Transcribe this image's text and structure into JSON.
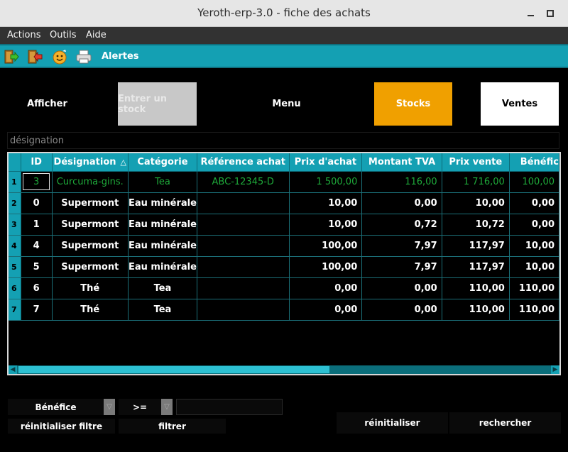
{
  "window": {
    "title": "Yeroth-erp-3.0 - fiche des achats"
  },
  "menubar": {
    "items": [
      "Actions",
      "Outils",
      "Aide"
    ]
  },
  "toolbar": {
    "alert_label": "Alertes"
  },
  "actions": {
    "afficher": "Afficher",
    "entrer_stock": "Entrer un stock",
    "menu": "Menu",
    "stocks": "Stocks",
    "ventes": "Ventes"
  },
  "search": {
    "placeholder": "désignation",
    "value": ""
  },
  "table": {
    "columns": [
      "ID",
      "Désignation",
      "Catégorie",
      "Référence achat",
      "Prix d'achat",
      "Montant TVA",
      "Prix vente",
      "Bénéfic"
    ],
    "sorted_column": "Désignation",
    "rows": [
      {
        "num": "1",
        "cells": [
          "3",
          "Curcuma-gins.",
          "Tea",
          "ABC-12345-D",
          "1 500,00",
          "116,00",
          "1 716,00",
          "100,00"
        ]
      },
      {
        "num": "2",
        "cells": [
          "0",
          "Supermont",
          "Eau minérale",
          "",
          "10,00",
          "0,00",
          "10,00",
          "0,00"
        ]
      },
      {
        "num": "3",
        "cells": [
          "1",
          "Supermont",
          "Eau minérale",
          "",
          "10,00",
          "0,72",
          "10,72",
          "0,00"
        ]
      },
      {
        "num": "4",
        "cells": [
          "4",
          "Supermont",
          "Eau minérale",
          "",
          "100,00",
          "7,97",
          "117,97",
          "10,00"
        ]
      },
      {
        "num": "5",
        "cells": [
          "5",
          "Supermont",
          "Eau minérale",
          "",
          "100,00",
          "7,97",
          "117,97",
          "10,00"
        ]
      },
      {
        "num": "6",
        "cells": [
          "6",
          "Thé",
          "Tea",
          "",
          "0,00",
          "0,00",
          "110,00",
          "110,00"
        ]
      },
      {
        "num": "7",
        "cells": [
          "7",
          "Thé",
          "Tea",
          "",
          "0,00",
          "0,00",
          "110,00",
          "110,00"
        ]
      }
    ]
  },
  "filter": {
    "field_selected": "Bénéfice",
    "operator_selected": ">=",
    "value": "",
    "reset_filter_label": "réinitialiser filtre",
    "apply_filter_label": "filtrer"
  },
  "bottom_buttons": {
    "reset_label": "réinitialiser",
    "search_label": "rechercher"
  },
  "colors": {
    "accent": "#14a0b3",
    "stocks_button": "#f0a000",
    "disabled_button": "#c8c8c8",
    "selected_row_text": "#1eaa3a"
  },
  "icons": [
    "enter-door-icon",
    "exit-door-icon",
    "smiley-icon",
    "printer-icon",
    "minimize-icon",
    "maximize-icon",
    "sort-ascending-icon",
    "dropdown-arrow-icon"
  ]
}
